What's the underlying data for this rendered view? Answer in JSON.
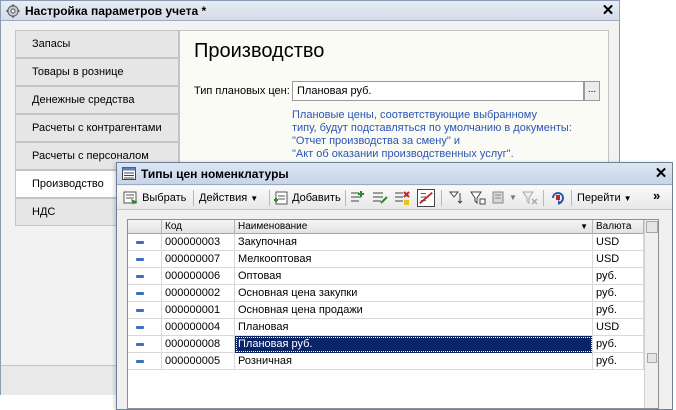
{
  "settings_window": {
    "title": "Настройка параметров учета *",
    "close_symbol": "✕",
    "sections": [
      {
        "label": "Запасы"
      },
      {
        "label": "Товары в рознице"
      },
      {
        "label": "Денежные средства"
      },
      {
        "label": "Расчеты с контрагентами"
      },
      {
        "label": "Расчеты с персоналом"
      },
      {
        "label": "Производство",
        "active": true
      },
      {
        "label": "НДС"
      }
    ],
    "panel": {
      "title": "Производство",
      "price_type_label": "Тип плановых цен:",
      "price_type_value": "Плановая руб.",
      "select_button": "...",
      "hint_lines": [
        "Плановые цены, соответствующие выбранному",
        "типу, будут подставляться по умолчанию в документы:",
        "\"Отчет производства за смену\" и",
        "\"Акт об оказании производственных услуг\"."
      ]
    }
  },
  "catalog_window": {
    "title": "Типы цен номенклатуры",
    "close_symbol": "✕",
    "toolbar": {
      "select_label": "Выбрать",
      "actions_label": "Действия",
      "add_label": "Добавить",
      "goto_label": "Перейти",
      "overflow_label": "»"
    },
    "columns": {
      "code": "Код",
      "name": "Наименование",
      "currency": "Валюта"
    },
    "rows": [
      {
        "code": "000000003",
        "name": "Закупочная",
        "currency": "USD"
      },
      {
        "code": "000000007",
        "name": "Мелкооптовая",
        "currency": "USD"
      },
      {
        "code": "000000006",
        "name": "Оптовая",
        "currency": "руб."
      },
      {
        "code": "000000002",
        "name": "Основная цена закупки",
        "currency": "руб."
      },
      {
        "code": "000000001",
        "name": "Основная цена продажи",
        "currency": "руб."
      },
      {
        "code": "000000004",
        "name": "Плановая",
        "currency": "USD"
      },
      {
        "code": "000000008",
        "name": "Плановая руб.",
        "currency": "руб.",
        "selected": true
      },
      {
        "code": "000000005",
        "name": "Розничная",
        "currency": "руб."
      }
    ]
  },
  "colors": {
    "selection": "#0a246a",
    "hint_text": "#2b55b5",
    "row_marker": "#3a6fc4"
  }
}
